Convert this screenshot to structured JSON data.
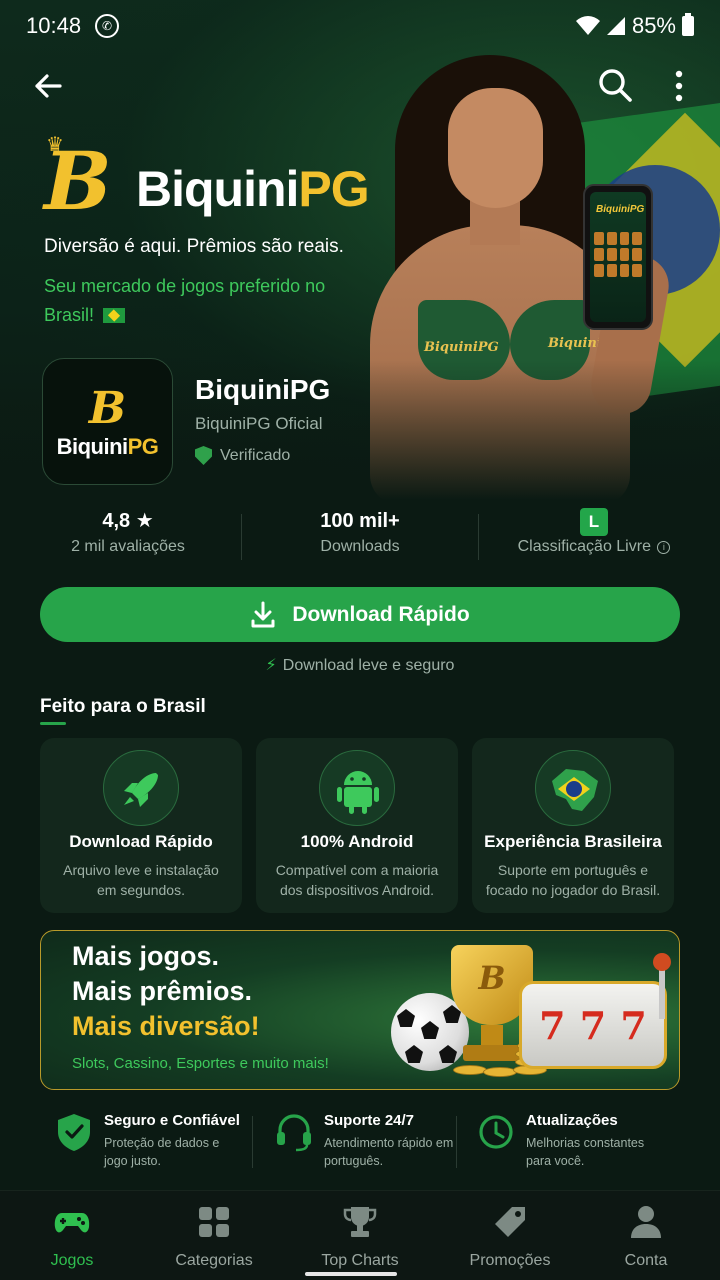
{
  "status_bar": {
    "time": "10:48",
    "battery": "85%"
  },
  "hero": {
    "brand_prefix": "Biquini",
    "brand_suffix": "PG",
    "tagline": "Diversão é aqui. Prêmios são reais.",
    "subtag": "Seu mercado de jogos preferido no Brasil!",
    "bikini_text_left": "BiquiniPG",
    "bikini_text_right": "Biquini",
    "phone_logo": "BiquiniPG"
  },
  "app": {
    "icon_prefix": "Biquini",
    "icon_suffix": "PG",
    "title": "BiquiniPG",
    "developer": "BiquiniPG Oficial",
    "verified": "Verificado"
  },
  "stats": [
    {
      "value": "4,8 ★",
      "label": "2 mil avaliações"
    },
    {
      "value": "100 mil+",
      "label": "Downloads"
    },
    {
      "value": "L",
      "label": "Classificação Livre"
    }
  ],
  "download": {
    "label": "Download Rápido",
    "note": "Download leve e seguro"
  },
  "section": {
    "title": "Feito para o Brasil"
  },
  "cards": [
    {
      "title": "Download Rápido",
      "desc": "Arquivo leve e instalação em segundos.",
      "icon": "rocket-icon"
    },
    {
      "title": "100% Android",
      "desc": "Compatível com a maioria dos dispositivos Android.",
      "icon": "android-icon"
    },
    {
      "title": "Experiência Brasileira",
      "desc": "Suporte em português e focado no jogador do Brasil.",
      "icon": "brazil-map-icon"
    }
  ],
  "promo": {
    "line1": "Mais jogos.",
    "line2": "Mais prêmios.",
    "line3": "Mais diversão!",
    "sub": "Slots, Cassino, Esportes e muito mais!",
    "slot_symbols": [
      "7",
      "7",
      "7"
    ]
  },
  "features": [
    {
      "title": "Seguro e Confiável",
      "desc": "Proteção de dados e jogo justo.",
      "icon": "shield-check-icon"
    },
    {
      "title": "Suporte 24/7",
      "desc": "Atendimento rápido em português.",
      "icon": "headset-icon"
    },
    {
      "title": "Atualizações",
      "desc": "Melhorias constantes para você.",
      "icon": "clock-icon"
    }
  ],
  "nav": [
    {
      "label": "Jogos",
      "icon": "gamepad-icon",
      "active": true
    },
    {
      "label": "Categorias",
      "icon": "grid-icon",
      "active": false
    },
    {
      "label": "Top Charts",
      "icon": "trophy-icon",
      "active": false
    },
    {
      "label": "Promoções",
      "icon": "tag-icon",
      "active": false
    },
    {
      "label": "Conta",
      "icon": "person-icon",
      "active": false
    }
  ],
  "colors": {
    "accent_green": "#27a44a",
    "gold": "#f2c12e",
    "background": "#0b1a13"
  }
}
